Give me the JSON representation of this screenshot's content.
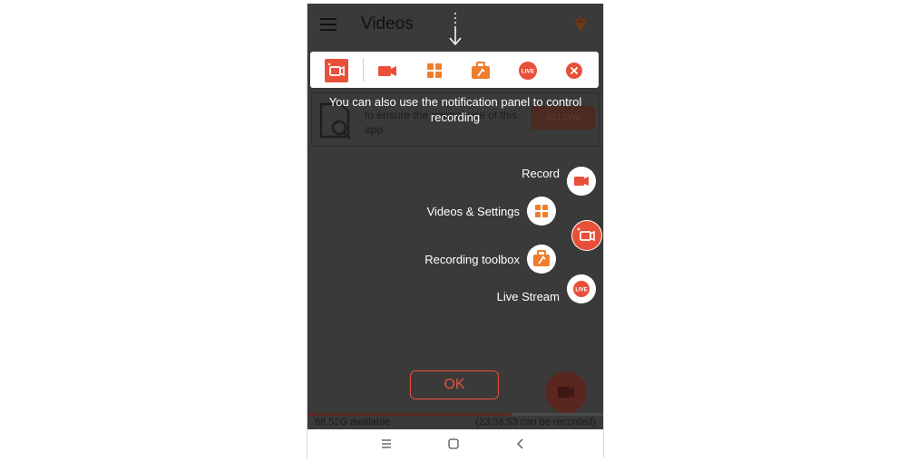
{
  "app": {
    "title": "Videos"
  },
  "background_card": {
    "text": "to ensure the normal use of this app",
    "allow_label": "ALLOW"
  },
  "hint": {
    "text": "You can also use the notification panel to control recording"
  },
  "toolbar": {
    "items": [
      {
        "name": "floating-bubble",
        "icon": "record-bubble-icon"
      },
      {
        "name": "record",
        "icon": "video-camera-icon"
      },
      {
        "name": "videos-settings",
        "icon": "grid-icon"
      },
      {
        "name": "toolbox",
        "icon": "toolbox-icon"
      },
      {
        "name": "live",
        "icon": "live-icon",
        "text": "LIVE"
      },
      {
        "name": "close",
        "icon": "close-icon"
      }
    ]
  },
  "floating_menu": {
    "record_label": "Record",
    "videos_settings_label": "Videos & Settings",
    "toolbox_label": "Recording toolbox",
    "live_label": "Live Stream",
    "live_badge": "LIVE"
  },
  "ok_label": "OK",
  "storage": {
    "available": "68.52G available",
    "recordable": "(23:38:53 can be recorded)",
    "used_fraction": 0.69
  },
  "colors": {
    "accent": "#e8503a",
    "orange": "#f07c2c",
    "overlay": "#3a3a3a"
  }
}
